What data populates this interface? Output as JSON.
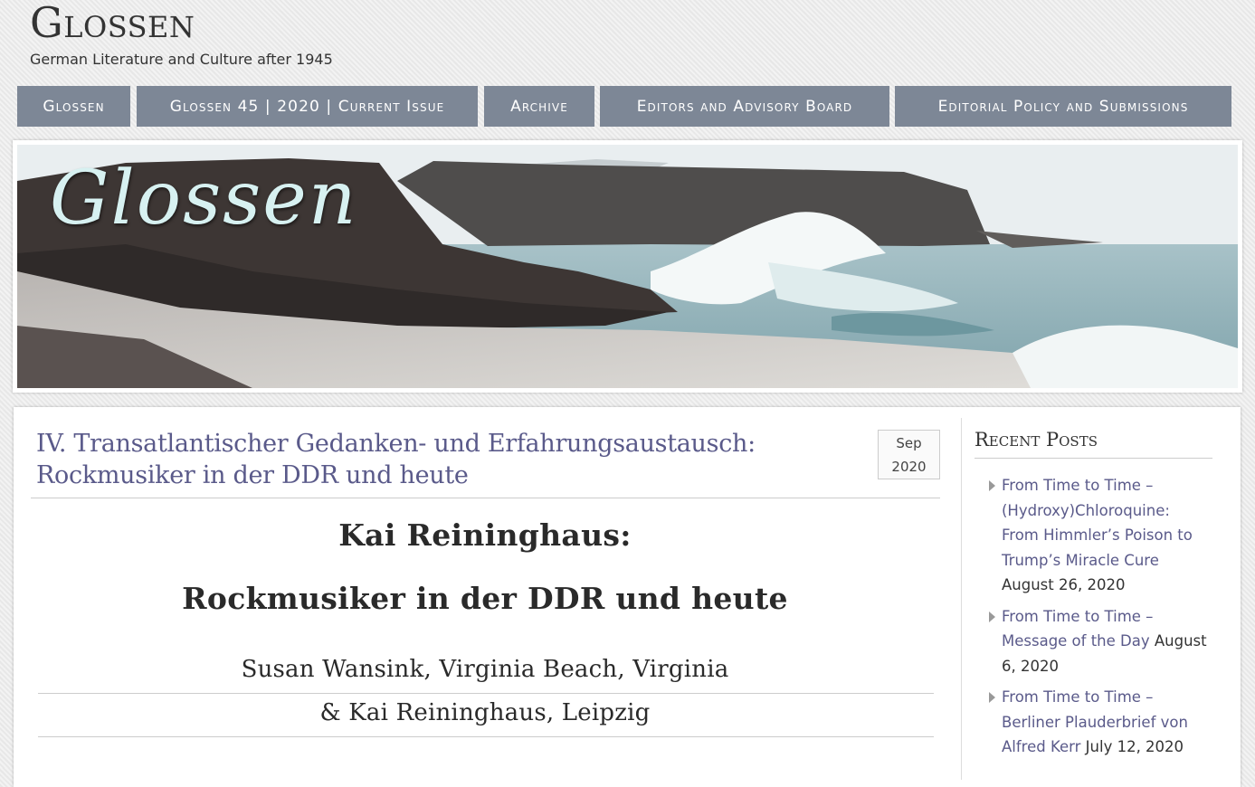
{
  "site": {
    "title": "Glossen",
    "description": "German Literature and Culture after 1945"
  },
  "nav": {
    "items": [
      {
        "label": "Glossen"
      },
      {
        "label": "Glossen 45 | 2020 | Current Issue"
      },
      {
        "label": "Archive"
      },
      {
        "label": "Editors and Advisory Board"
      },
      {
        "label": "Editorial Policy and Submissions"
      }
    ]
  },
  "banner": {
    "title": "Glossen"
  },
  "post": {
    "title_line1": "IV. Transatlantischer Gedanken- und Erfahrungsaustausch:",
    "title_line2": "Rockmusiker in der DDR und heute",
    "date_month": "Sep",
    "date_year": "2020",
    "heading1": "Kai Reininghaus:",
    "heading2": "Rockmusiker in der DDR und heute",
    "author_line1": "Susan Wansink, Virginia Beach, Virginia",
    "author_line2": "& Kai Reininghaus, Leipzig"
  },
  "sidebar": {
    "widget_title": "Recent Posts",
    "recent_posts": [
      {
        "title": "From Time to Time – (Hydroxy)Chloroquine: From Himmler’s Poison to Trump’s Miracle Cure",
        "date": "August 26, 2020"
      },
      {
        "title": "From Time to Time – Message of the Day",
        "date": "August 6, 2020"
      },
      {
        "title": "From Time to Time – Berliner Plauderbrief von Alfred Kerr",
        "date": "July 12, 2020"
      }
    ]
  },
  "colors": {
    "nav_background": "#7d8796",
    "link": "#5a5a8a",
    "page_background": "#ececec"
  }
}
